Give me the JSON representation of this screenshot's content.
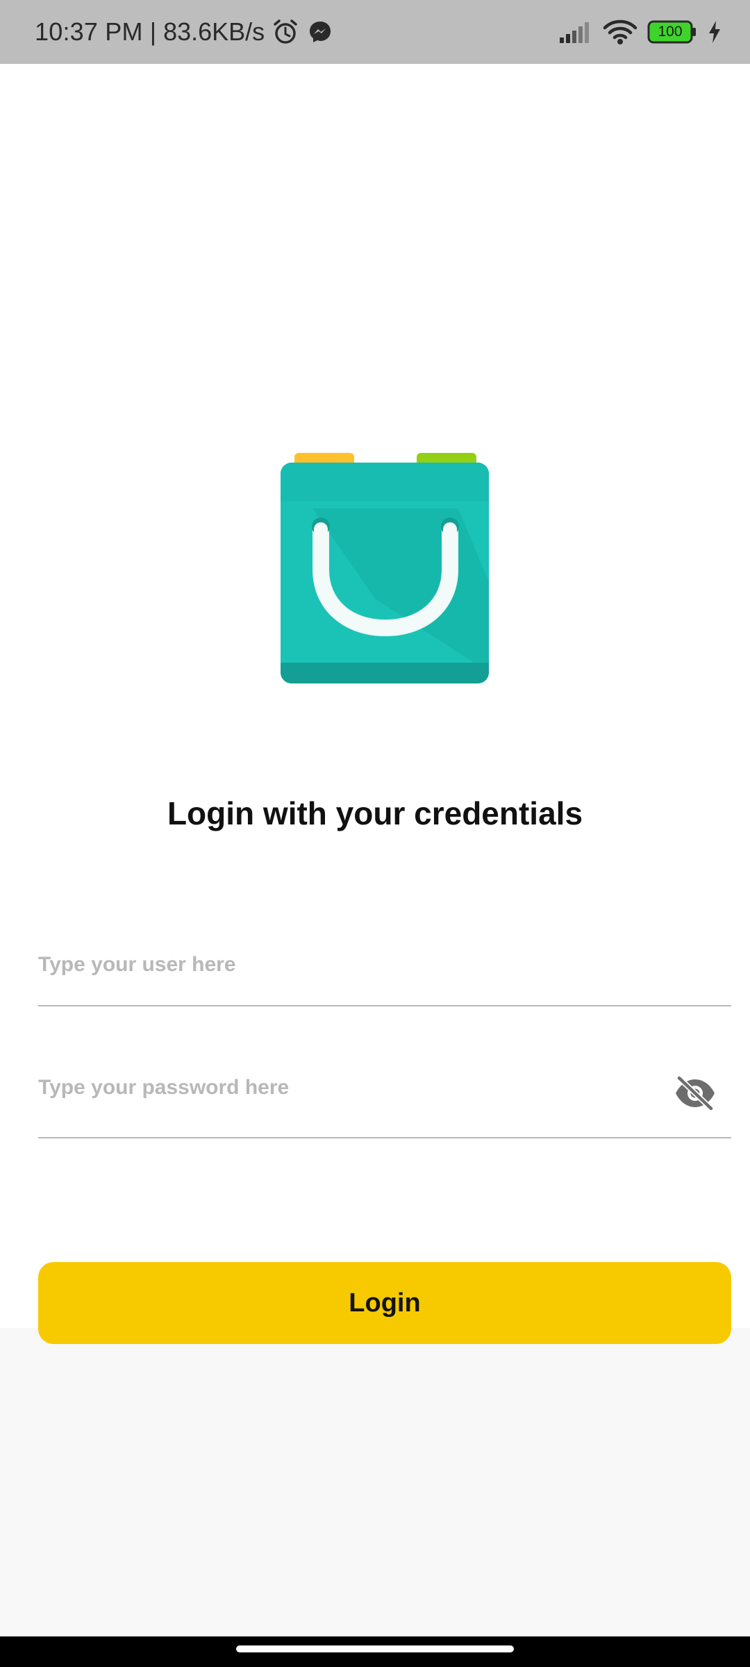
{
  "status_bar": {
    "time": "10:37 PM",
    "separator": "|",
    "network_speed": "83.6KB/s",
    "battery_level": "100",
    "icons": [
      "alarm-icon",
      "messenger-icon",
      "signal-icon",
      "wifi-icon",
      "battery-icon",
      "charging-icon"
    ]
  },
  "login": {
    "title": "Login with your credentials",
    "user_placeholder": "Type your user here",
    "password_placeholder": "Type your password here",
    "toggle_visibility_icon": "eye-off-icon",
    "button_label": "Login"
  },
  "colors": {
    "button_bg": "#f7ca00",
    "status_bar_bg": "#bdbdbd",
    "bag_teal": "#1bc3b6",
    "tab_orange": "#ffc02e",
    "tab_purple": "#a34fc0",
    "tab_green": "#8ccc10"
  }
}
